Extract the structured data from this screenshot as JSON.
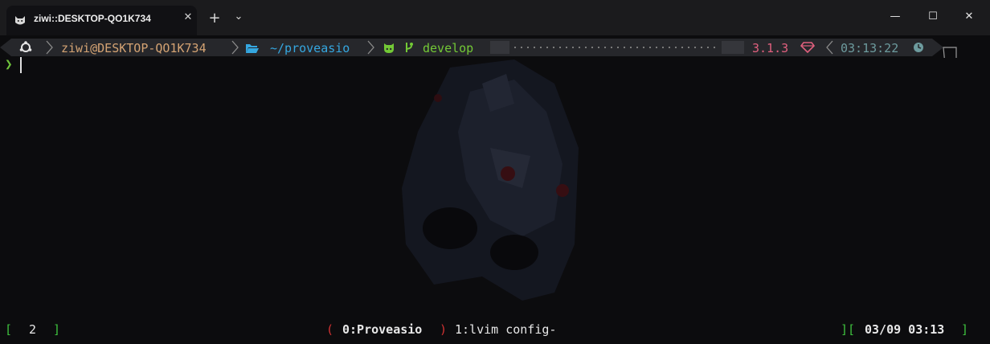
{
  "window": {
    "tab_title": "ziwi::DESKTOP-QO1K734",
    "tab_icon": "cat-icon",
    "new_tab_label": "+",
    "dropdown_label": "⌄",
    "close_tab_label": "✕",
    "minimize_label": "—",
    "maximize_label": "☐",
    "close_label": "✕"
  },
  "prompt": {
    "user_host": "ziwi@DESKTOP-QO1K734",
    "path": "~/proveasio",
    "branch": "develop",
    "ruby_version": "3.1.3",
    "time": "03:13:22",
    "chevron": "❯",
    "icons": [
      "os-logo-icon",
      "folder-open-icon",
      "github-icon",
      "git-branch-icon",
      "ruby-gem-icon",
      "clock-icon"
    ]
  },
  "statusbar": {
    "left_open": "[",
    "session_count": "2",
    "left_close": "]",
    "window0_open": "(",
    "window0": "0:Proveasio",
    "window0_close": ")",
    "window1": "1:lvim config-",
    "right_open": "][",
    "datetime": "03/09 03:13",
    "right_close": "]"
  },
  "colors": {
    "titlebar": "#1b1b1d",
    "terminal_bg": "#0c0c0e",
    "powerline_bg": "#26272b",
    "user_host": "#d4a373",
    "path": "#35a7e0",
    "git": "#73c936",
    "ruby": "#e0607e",
    "time": "#6d9b9e",
    "status_green": "#3ec13e",
    "status_red": "#d23232",
    "status_text": "#e8e8e8"
  }
}
